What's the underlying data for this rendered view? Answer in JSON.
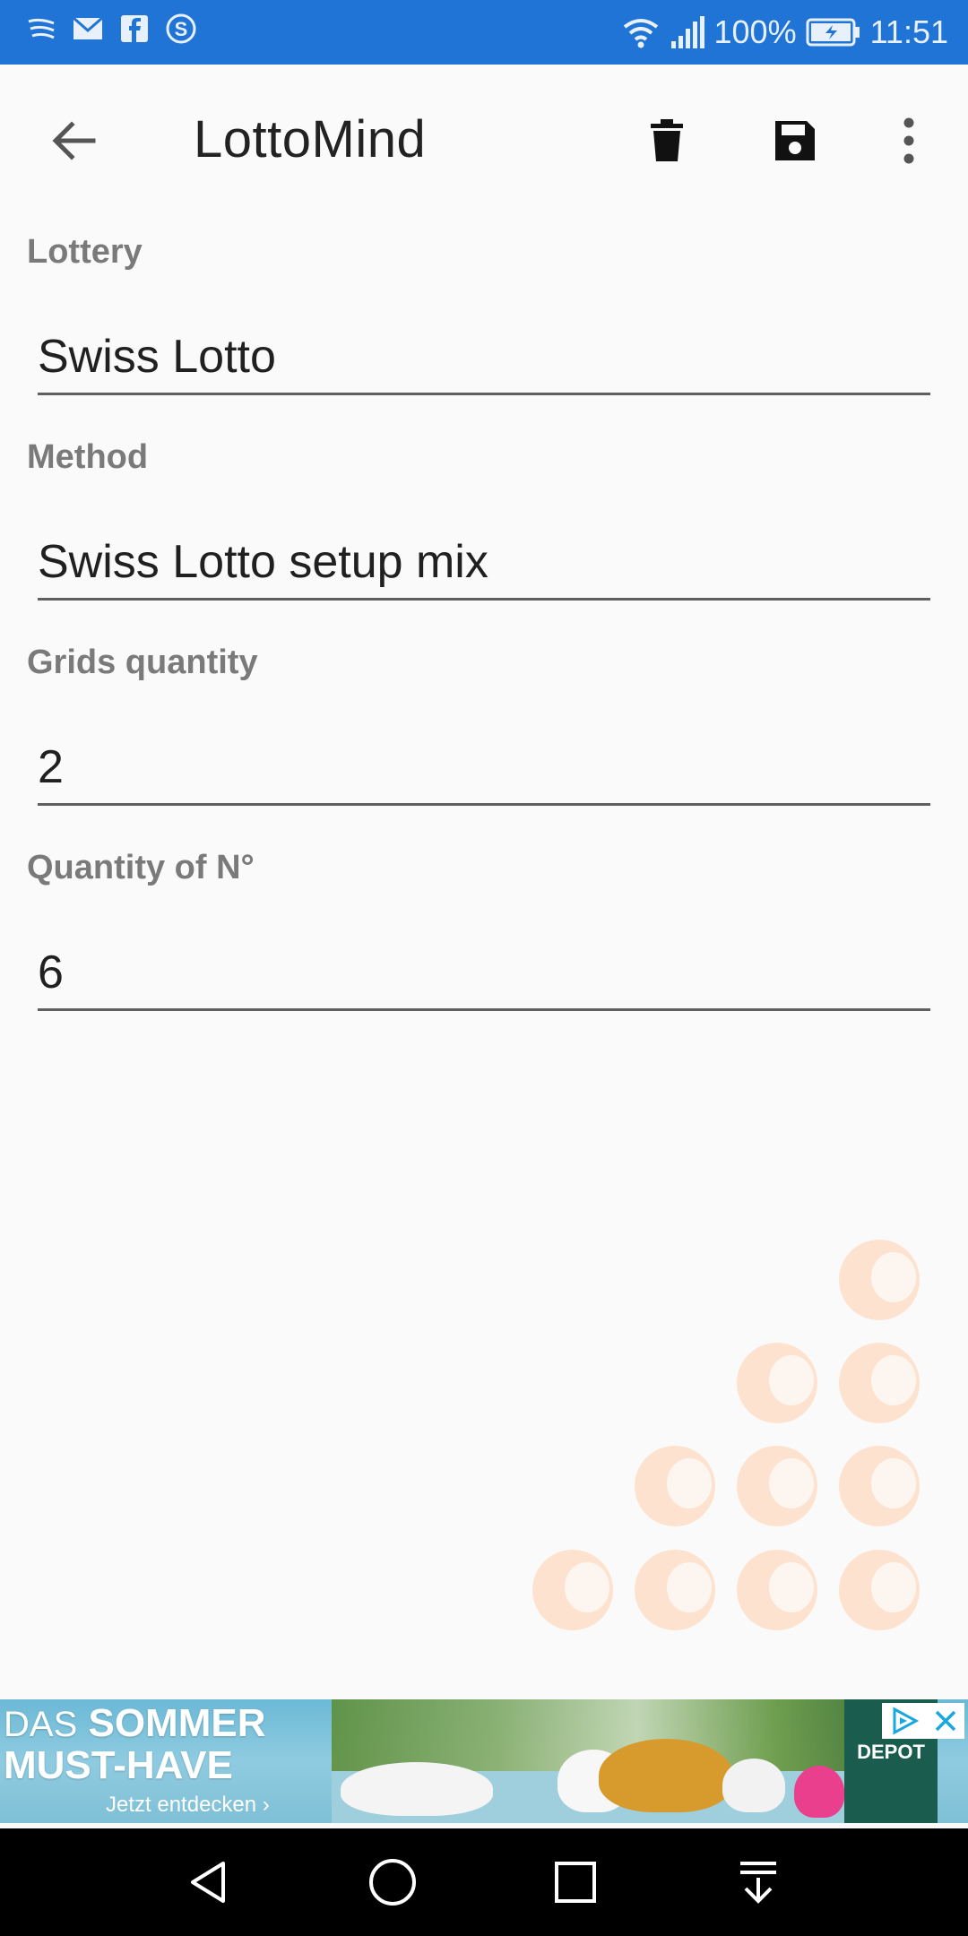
{
  "status_bar": {
    "battery": "100%",
    "time": "11:51",
    "left_icons": [
      "swiftkey-icon",
      "mail-icon",
      "facebook-icon",
      "skype-icon"
    ],
    "right_icons": [
      "wifi-icon",
      "signal-icon",
      "battery-icon"
    ],
    "background_color": "#1f74d6"
  },
  "app_bar": {
    "title": "LottoMind",
    "actions": [
      "back-icon",
      "delete-icon",
      "save-icon",
      "more-vert-icon"
    ]
  },
  "form": {
    "lottery": {
      "label": "Lottery",
      "value": "Swiss Lotto"
    },
    "method": {
      "label": "Method",
      "value": "Swiss Lotto setup mix"
    },
    "grids_quantity": {
      "label": "Grids quantity",
      "value": "2"
    },
    "quantity_of_numbers": {
      "label": "Quantity of N°",
      "value": "6"
    }
  },
  "decoration": {
    "ball_color": "#fde3cf"
  },
  "ad": {
    "headline_1_light": "DAS",
    "headline_1_bold": "SOMMER",
    "headline_2": "MUST-HAVE",
    "cta": "Jetzt entdecken ›",
    "brand": "DEPOT"
  },
  "nav_bar": {
    "buttons": [
      "back-triangle-icon",
      "home-circle-icon",
      "recents-square-icon",
      "notification-pull-icon"
    ]
  }
}
